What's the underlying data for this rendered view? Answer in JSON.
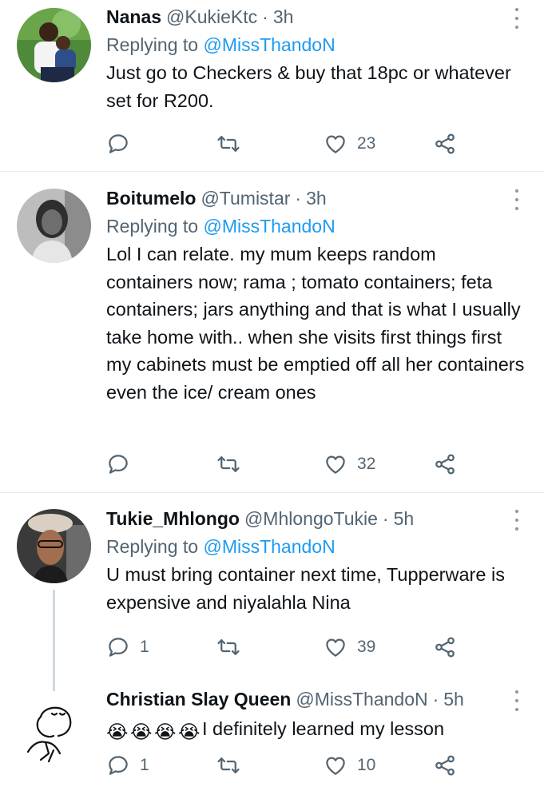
{
  "replying_prefix": "Replying to",
  "tweets": [
    {
      "name": "Nanas",
      "handle": "@KukieKtc",
      "dot": "·",
      "time": "3h",
      "replying_to": "@MissThandoN",
      "text": "Just go to Checkers & buy that 18pc or whatever set for R200.",
      "replies": "",
      "retweets": "",
      "likes": "23",
      "avatar_icon": "avatar-photo-woman-child"
    },
    {
      "name": "Boitumelo",
      "handle": "@Tumistar",
      "dot": "·",
      "time": "3h",
      "replying_to": "@MissThandoN",
      "text": "Lol I can relate. my mum keeps random containers now; rama ; tomato containers; feta containers; jars anything  and that is what I usually take home with.. when she visits first things first my cabinets must be emptied off all her containers even the ice/ cream ones",
      "replies": "",
      "retweets": "",
      "likes": "32",
      "avatar_icon": "avatar-photo-grayscale-woman"
    },
    {
      "name": "Tukie_Mhlongo",
      "handle": "@MhlongoTukie",
      "dot": "·",
      "time": "5h",
      "replying_to": "@MissThandoN",
      "text": "U must bring container next time, Tupperware is expensive and niyalahla Nina",
      "replies": "1",
      "retweets": "",
      "likes": "39",
      "avatar_icon": "avatar-photo-woman-cap"
    },
    {
      "name": "Christian Slay Queen",
      "handle": "@MissThandoN",
      "dot": "·",
      "time": "5h",
      "text": "I definitely learned my lesson",
      "emoji": [
        "😭",
        "😭",
        "😭",
        "😭"
      ],
      "replies": "1",
      "retweets": "",
      "likes": "10",
      "avatar_icon": "avatar-sketch-drawing"
    }
  ],
  "icons": {
    "reply": "reply-icon",
    "retweet": "retweet-icon",
    "like": "heart-icon",
    "share": "share-icon",
    "more": "more-options-icon"
  },
  "colors": {
    "text": "#0f1419",
    "secondary": "#536471",
    "mention": "#1d9bf0",
    "divider": "#e6ecf0"
  }
}
